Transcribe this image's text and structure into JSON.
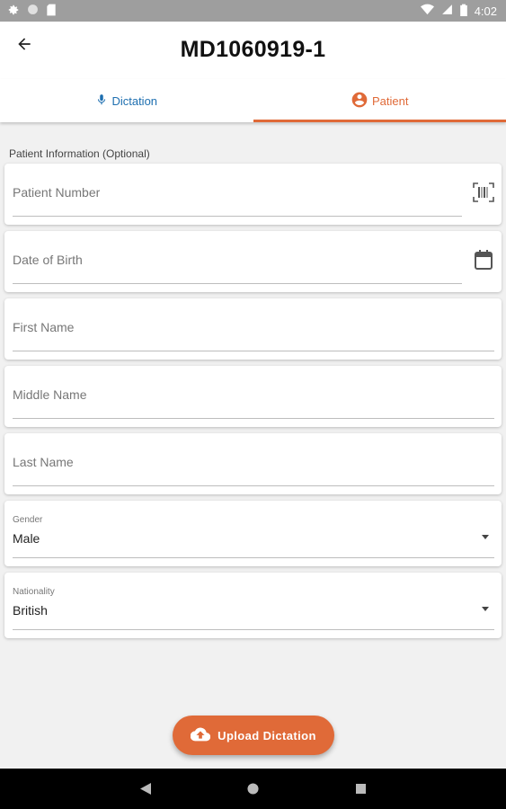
{
  "status_bar": {
    "time": "4:02",
    "left_icons": [
      "settings-icon",
      "circle-icon",
      "sd-card-icon"
    ],
    "right_icons": [
      "wifi-icon",
      "signal-icon",
      "battery-icon"
    ]
  },
  "app_bar": {
    "title": "MD1060919-1",
    "back_icon": "arrow-back-icon"
  },
  "tabs": [
    {
      "label": "Dictation",
      "icon": "mic-icon",
      "selected": false,
      "color": "#1e6fb0"
    },
    {
      "label": "Patient",
      "icon": "account-circle-icon",
      "selected": true,
      "color": "#e06a38"
    }
  ],
  "form": {
    "section_label": "Patient Information (Optional)",
    "patient_number": {
      "placeholder": "Patient Number",
      "icon": "barcode-scan-icon"
    },
    "date_of_birth": {
      "placeholder": "Date of Birth",
      "icon": "calendar-icon"
    },
    "first_name": {
      "placeholder": "First Name"
    },
    "middle_name": {
      "placeholder": "Middle Name"
    },
    "last_name": {
      "placeholder": "Last Name"
    },
    "gender": {
      "label": "Gender",
      "value": "Male"
    },
    "nationality": {
      "label": "Nationality",
      "value": "British"
    }
  },
  "upload_button": {
    "label": "Upload Dictation",
    "icon": "cloud-upload-icon",
    "color": "#e06a38"
  },
  "nav_bar": {
    "icons": [
      "back-triangle-icon",
      "home-circle-icon",
      "recents-square-icon"
    ]
  }
}
